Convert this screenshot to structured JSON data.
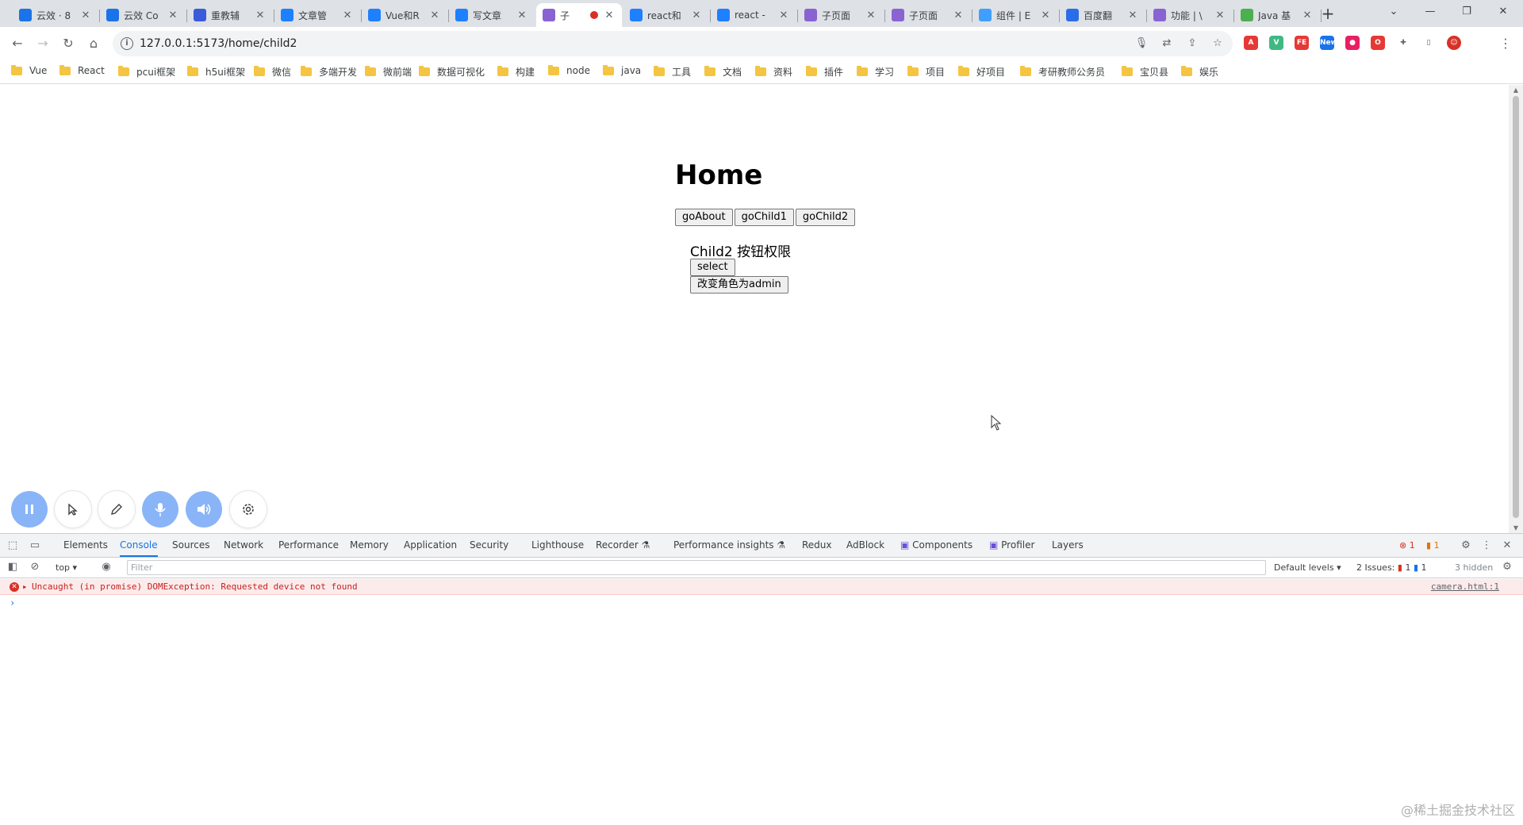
{
  "browser": {
    "tabs": [
      {
        "label": "云效 · 8",
        "icon": "yunxiao-icon",
        "color": "#1a73e8"
      },
      {
        "label": "云效 Co",
        "icon": "yunxiao-c-icon",
        "color": "#1a73e8"
      },
      {
        "label": "重教辅",
        "icon": "search-site-icon",
        "color": "#3b5bdb"
      },
      {
        "label": "文章管",
        "icon": "juejin-icon",
        "color": "#1e80ff"
      },
      {
        "label": "Vue和R",
        "icon": "juejin-icon",
        "color": "#1e80ff"
      },
      {
        "label": "写文章",
        "icon": "juejin-icon",
        "color": "#1e80ff"
      },
      {
        "label": "子",
        "icon": "vite-icon",
        "color": "#8a63d2",
        "active": true,
        "recording": true
      },
      {
        "label": "react和",
        "icon": "juejin-icon",
        "color": "#1e80ff"
      },
      {
        "label": "react -",
        "icon": "juejin-icon",
        "color": "#1e80ff"
      },
      {
        "label": "子页面",
        "icon": "vite-icon",
        "color": "#8a63d2"
      },
      {
        "label": "子页面",
        "icon": "vite-icon",
        "color": "#8a63d2"
      },
      {
        "label": "组件 | E",
        "icon": "element-icon",
        "color": "#409eff"
      },
      {
        "label": "百度翻",
        "icon": "baidu-translate-icon",
        "color": "#2b6de8"
      },
      {
        "label": "功能 | \\",
        "icon": "vite-icon",
        "color": "#8a63d2"
      },
      {
        "label": "Java 基",
        "icon": "runoob-icon",
        "color": "#4caf50"
      }
    ],
    "new_tab_symbol": "+",
    "url": "127.0.0.1:5173/home/child2",
    "bookmarks": [
      "Vue",
      "React",
      "pcui框架",
      "h5ui框架",
      "微信",
      "多端开发",
      "微前端",
      "数据可视化",
      "构建",
      "node",
      "java",
      "工具",
      "文档",
      "资料",
      "插件",
      "学习",
      "项目",
      "好项目",
      "考研教师公务员",
      "宝贝县",
      "娱乐"
    ],
    "extensions": [
      {
        "name": "adblock-icon",
        "color": "#e53935",
        "glyph": "A"
      },
      {
        "name": "vue-devtools-icon",
        "color": "#41b883",
        "glyph": "V"
      },
      {
        "name": "fe-helper-icon",
        "color": "#e53935",
        "glyph": "FE"
      },
      {
        "name": "new-badge-icon",
        "color": "#1a73e8",
        "glyph": "New"
      },
      {
        "name": "record-icon",
        "color": "#e91e63",
        "glyph": "●"
      },
      {
        "name": "opera-icon",
        "color": "#e53935",
        "glyph": "O"
      },
      {
        "name": "extensions-puzzle-icon",
        "color": "#5f6368",
        "glyph": "✚"
      },
      {
        "name": "side-panel-icon",
        "color": "#5f6368",
        "glyph": "▯"
      },
      {
        "name": "profile-avatar-icon",
        "color": "#d93025",
        "glyph": "☺"
      }
    ]
  },
  "page": {
    "title": "Home",
    "nav_buttons": [
      "goAbout",
      "goChild1",
      "goChild2"
    ],
    "child_title": "Child2 按钮权限",
    "select_button": "select",
    "change_role_button": "改变角色为admin"
  },
  "devtools": {
    "tabs": [
      "Elements",
      "Console",
      "Sources",
      "Network",
      "Performance",
      "Memory",
      "Application",
      "Security",
      "Lighthouse",
      "Recorder ⚗",
      "Performance insights ⚗",
      "Redux",
      "AdBlock",
      "Components",
      "Profiler",
      "Layers"
    ],
    "active_tab": "Console",
    "error_count": "1",
    "warning_count": "1",
    "context": "top",
    "filter_placeholder": "Filter",
    "default_levels": "Default levels ▾",
    "issues_label": "2 Issues:",
    "issues_errors": "1",
    "issues_info": "1",
    "hidden_label": "3 hidden",
    "error_message": "Uncaught (in promise) DOMException: Requested device not found",
    "error_source": "camera.html:1",
    "prompt": "›"
  },
  "watermark": "@稀土掘金技术社区"
}
